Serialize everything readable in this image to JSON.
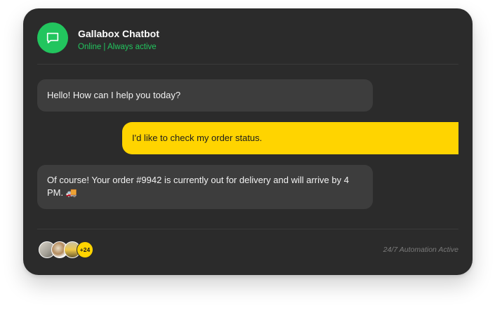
{
  "header": {
    "title": "Gallabox Chatbot",
    "status": "Online | Always active",
    "icon": "chat-bubble-icon",
    "accent": "#22c55e"
  },
  "messages": [
    {
      "from": "bot",
      "text": "Hello! How can I help you today?"
    },
    {
      "from": "user",
      "text": "I'd like to check my order status."
    },
    {
      "from": "bot",
      "text": "Of course! Your order #9942 is currently out for delivery and will arrive by 4 PM. 🚚"
    }
  ],
  "footer": {
    "extra_count": "+24",
    "note": "24/7 Automation Active"
  },
  "colors": {
    "card_bg": "#2b2b2b",
    "bot_bubble": "#3d3d3d",
    "user_bubble": "#ffd400"
  }
}
